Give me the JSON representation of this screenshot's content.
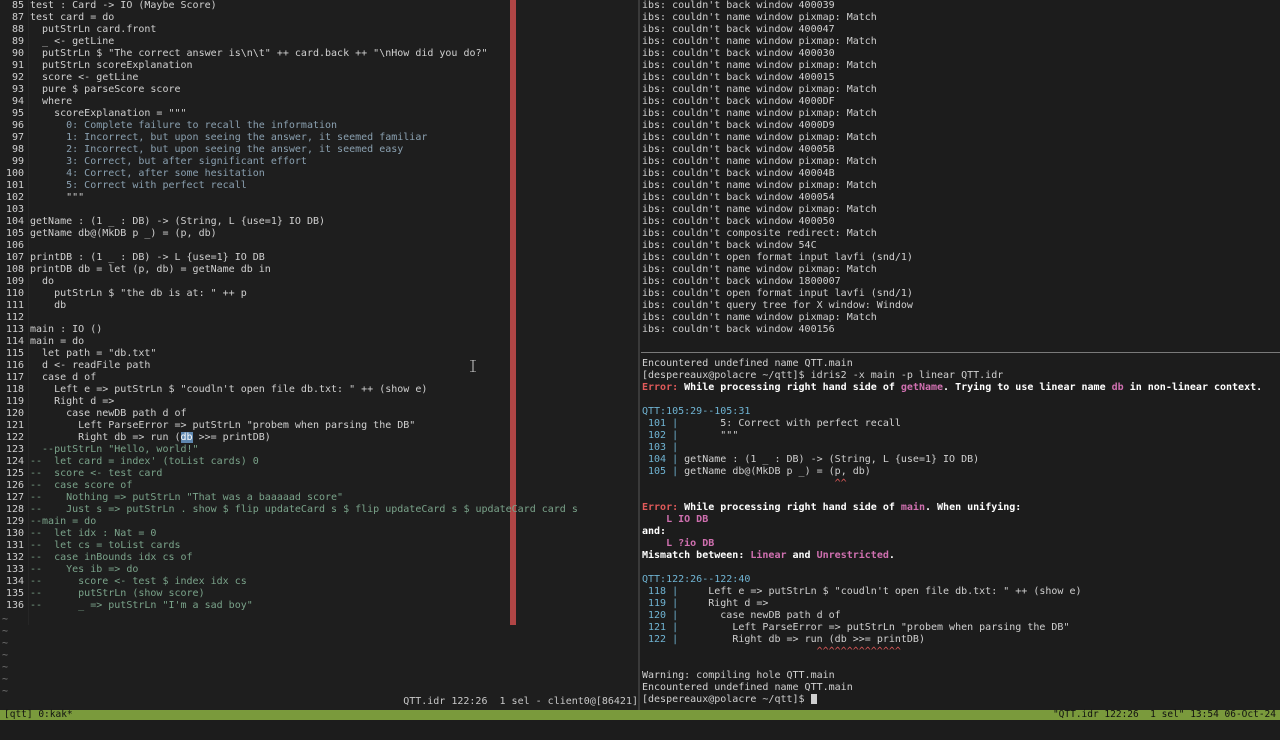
{
  "editor": {
    "lines": [
      {
        "n": "85",
        "t": "test : Card -> IO (Maybe Score)"
      },
      {
        "n": "86",
        "t": "test card = do"
      },
      {
        "n": "87",
        "t": "  putStrLn card.front"
      },
      {
        "n": "88",
        "t": "  _ <- getLine"
      },
      {
        "n": "89",
        "t": "  putStrLn $ \"The correct answer is\\n\\t\" ++ card.back ++ \"\\nHow did you do?\""
      },
      {
        "n": "90",
        "t": "  putStrLn scoreExplanation"
      },
      {
        "n": "91",
        "t": "  score <- getLine"
      },
      {
        "n": "92",
        "t": "  pure $ parseScore score"
      },
      {
        "n": "93",
        "t": "  where"
      },
      {
        "n": "94",
        "t": "    scoreExplanation = \"\"\""
      },
      {
        "n": "95",
        "t": "      0: Complete failure to recall the information"
      },
      {
        "n": "96",
        "t": "      1: Incorrect, but upon seeing the answer, it seemed familiar"
      },
      {
        "n": "97",
        "t": "      2: Incorrect, but upon seeing the answer, it seemed easy"
      },
      {
        "n": "98",
        "t": "      3: Correct, but after significant effort"
      },
      {
        "n": "99",
        "t": "      4: Correct, after some hesitation"
      },
      {
        "n": "100",
        "t": "      5: Correct with perfect recall"
      },
      {
        "n": "101",
        "t": "      \"\"\""
      },
      {
        "n": "102",
        "t": ""
      },
      {
        "n": "103",
        "t": "getName : (1 _ : DB) -> (String, L {use=1} IO DB)"
      },
      {
        "n": "104",
        "t": "getName db@(MkDB p _) = (p, db)"
      },
      {
        "n": "105",
        "t": ""
      },
      {
        "n": "106",
        "t": "printDB : (1 _ : DB) -> L {use=1} IO DB"
      },
      {
        "n": "107",
        "t": "printDB db = let (p, db) = getName db in"
      },
      {
        "n": "108",
        "t": "  do"
      },
      {
        "n": "109",
        "t": "    putStrLn $ \"the db is at: \" ++ p"
      },
      {
        "n": "110",
        "t": "    db"
      },
      {
        "n": "111",
        "t": ""
      },
      {
        "n": "112",
        "t": "main : IO ()"
      },
      {
        "n": "113",
        "t": "main = do"
      },
      {
        "n": "114",
        "t": "  let path = \"db.txt\""
      },
      {
        "n": "115",
        "t": "  d <- readFile path"
      },
      {
        "n": "116",
        "t": "  case d of"
      },
      {
        "n": "117",
        "t": "    Left e => putStrLn $ \"coudln't open file db.txt: \" ++ (show e)"
      },
      {
        "n": "118",
        "t": "    Right d =>"
      },
      {
        "n": "119",
        "t": "      case newDB path d of"
      },
      {
        "n": "120",
        "t": "        Left ParseError => putStrLn \"probem when parsing the DB\""
      },
      {
        "n": "121",
        "t": "        Right db => run (db >>= printDB)"
      },
      {
        "n": "122",
        "t": "  --putStrLn \"Hello, world!\""
      },
      {
        "n": "123",
        "t": "--  let card = index' (toList cards) 0"
      },
      {
        "n": "124",
        "t": "--  score <- test card"
      },
      {
        "n": "125",
        "t": "--  case score of"
      },
      {
        "n": "126",
        "t": "--    Nothing => putStrLn \"That was a baaaaad score\""
      },
      {
        "n": "127",
        "t": "--    Just s => putStrLn . show $ flip updateCard s $ flip updateCard s $ updateCard card s"
      },
      {
        "n": "128",
        "t": "--main = do"
      },
      {
        "n": "129",
        "t": "--  let idx : Nat = 0"
      },
      {
        "n": "130",
        "t": "--  let cs = toList cards"
      },
      {
        "n": "131",
        "t": "--  case inBounds idx cs of"
      },
      {
        "n": "132",
        "t": "--    Yes ib => do"
      },
      {
        "n": "133",
        "t": "--      score <- test $ index idx cs"
      },
      {
        "n": "134",
        "t": "--      putStrLn (show score)"
      },
      {
        "n": "135",
        "t": "--      _ => putStrLn \"I'm a sad boy\""
      }
    ],
    "display_numbers": [
      "85",
      "87",
      "88",
      "89",
      "90",
      "91",
      "92",
      "93",
      "94",
      "95",
      "96",
      "97",
      "98",
      "99",
      "100",
      "101",
      "102",
      "103",
      "104",
      "105",
      "106",
      "107",
      "108",
      "109",
      "110",
      "111",
      "112",
      "113",
      "114",
      "115",
      "116",
      "117",
      "118",
      "119",
      "120",
      "121",
      "122",
      "123",
      "124",
      "125",
      "126",
      "127",
      "128",
      "129",
      "130",
      "131",
      "132",
      "133",
      "134",
      "135",
      "136"
    ],
    "status": "QTT.idr 122:26  1 sel - client0@[86421]"
  },
  "terminal_top": {
    "lines": [
      "ibs: couldn't back window 400039",
      "ibs: couldn't name window pixmap: Match",
      "ibs: couldn't back window 400047",
      "ibs: couldn't name window pixmap: Match",
      "ibs: couldn't back window 400030",
      "ibs: couldn't name window pixmap: Match",
      "ibs: couldn't back window 400015",
      "ibs: couldn't name window pixmap: Match",
      "ibs: couldn't back window 4000DF",
      "ibs: couldn't name window pixmap: Match",
      "ibs: couldn't back window 4000D9",
      "ibs: couldn't name window pixmap: Match",
      "ibs: couldn't back window 40005B",
      "ibs: couldn't name window pixmap: Match",
      "ibs: couldn't back window 40004B",
      "ibs: couldn't name window pixmap: Match",
      "ibs: couldn't back window 400054",
      "ibs: couldn't name window pixmap: Match",
      "ibs: couldn't back window 400050",
      "ibs: couldn't composite redirect: Match",
      "ibs: couldn't back window 54C",
      "ibs: couldn't open format input lavfi (snd/1)",
      "ibs: couldn't name window pixmap: Match",
      "ibs: couldn't back window 1800007",
      "ibs: couldn't open format input lavfi (snd/1)",
      "ibs: couldn't query tree for X window: Window",
      "ibs: couldn't name window pixmap: Match",
      "ibs: couldn't back window 400156"
    ]
  },
  "terminal_bottom": {
    "undefined1": "Encountered undefined name QTT.main",
    "prompt1": "[despereaux@polacre ~/qtt]$ idris2 -x main -p linear QTT.idr",
    "err1_prefix": "Error:",
    "err1_text": " While processing right hand side of ",
    "err1_name": "getName",
    "err1_tail": ". Trying to use linear name ",
    "err1_var": "db",
    "err1_end": " in non-linear context.",
    "loc1": "QTT:105:29--105:31",
    "snippet1": [
      {
        "n": "101",
        "t": "      5: Correct with perfect recall"
      },
      {
        "n": "102",
        "t": "      \"\"\""
      },
      {
        "n": "103",
        "t": ""
      },
      {
        "n": "104",
        "t": "getName : (1 _ : DB) -> (String, L {use=1} IO DB)"
      },
      {
        "n": "105",
        "t": "getName db@(MkDB p _) = (p, db)"
      }
    ],
    "caret1": "                                ^^",
    "err2_prefix": "Error:",
    "err2_text": " While processing right hand side of ",
    "err2_name": "main",
    "err2_end": ". When unifying:",
    "unify_a": "    L IO DB",
    "and": "and:",
    "unify_b": "    L ?io DB",
    "mismatch_pre": "Mismatch between: ",
    "mismatch_a": "Linear",
    "mismatch_mid": " and ",
    "mismatch_b": "Unrestricted",
    "mismatch_end": ".",
    "loc2": "QTT:122:26--122:40",
    "snippet2": [
      {
        "n": "118",
        "t": "    Left e => putStrLn $ \"coudln't open file db.txt: \" ++ (show e)"
      },
      {
        "n": "119",
        "t": "    Right d =>"
      },
      {
        "n": "120",
        "t": "      case newDB path d of"
      },
      {
        "n": "121",
        "t": "        Left ParseError => putStrLn \"probem when parsing the DB\""
      },
      {
        "n": "122",
        "t": "        Right db => run (db >>= printDB)"
      }
    ],
    "caret2": "                             ^^^^^^^^^^^^^^",
    "warn": "Warning: compiling hole QTT.main",
    "undefined2": "Encountered undefined name QTT.main",
    "prompt2": "[despereaux@polacre ~/qtt]$ "
  },
  "tmux": {
    "left": "[qtt] 0:kak*",
    "right": "\"QTT.idr 122:26  1 sel\" 13:54 06-Oct-24"
  },
  "colors": {
    "status_bar": "#7a9a3c",
    "color_column": "#b04545",
    "error": "#e05a5a"
  }
}
